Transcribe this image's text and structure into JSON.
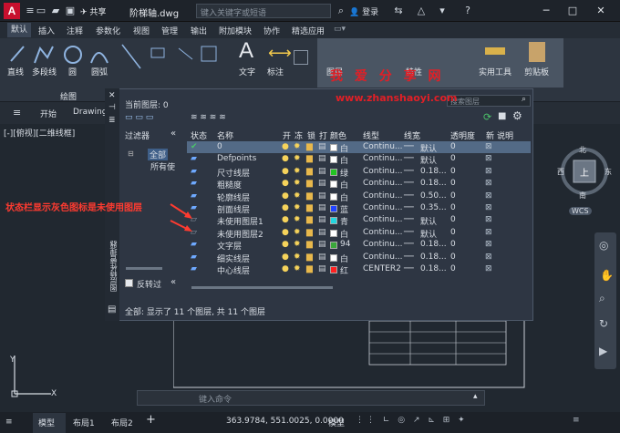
{
  "app": {
    "logo": "A",
    "file_title": "阶梯轴.dwg",
    "share_label": "共享",
    "search_placeholder": "键入关键字或短语",
    "login_label": "登录"
  },
  "ribbon_tabs": [
    "默认",
    "插入",
    "注释",
    "参数化",
    "视图",
    "管理",
    "输出",
    "附加模块",
    "协作",
    "精选应用"
  ],
  "ribbon": {
    "draw_tools": [
      "直线",
      "多段线",
      "圆",
      "圆弧"
    ],
    "text_label": "文字",
    "dim_label": "标注",
    "group_label": "绘图",
    "layer_label": "图层",
    "properties_label": "特性",
    "utilities_label": "实用工具",
    "clipboard_label": "剪贴板"
  },
  "subbar": {
    "start_tab": "开始",
    "drawing_tab": "Drawing"
  },
  "viewport_label": "[-][俯视][二维线框]",
  "layer_manager": {
    "current_layer": "当前图层: 0",
    "search_placeholder": "搜索图层",
    "filter_header": "过滤器",
    "filter_all": "全部",
    "filter_used": "所有使",
    "invert_filter": "反转过",
    "side_title": "图层特性管理器",
    "columns": [
      "状态",
      "名称",
      "开",
      "冻",
      "锁",
      "打",
      "颜色",
      "线型",
      "线宽",
      "透明度",
      "新",
      "说明"
    ],
    "rows": [
      {
        "name": "0",
        "color_name": "白",
        "color": "#ffffff",
        "linetype": "Continu...",
        "lineweight": "默认",
        "transparency": "0",
        "selected": true,
        "current": true
      },
      {
        "name": "Defpoints",
        "color_name": "白",
        "color": "#ffffff",
        "linetype": "Continu...",
        "lineweight": "默认",
        "transparency": "0"
      },
      {
        "name": "尺寸线层",
        "color_name": "绿",
        "color": "#22c522",
        "linetype": "Continu...",
        "lineweight": "0.18...",
        "transparency": "0"
      },
      {
        "name": "粗糙度",
        "color_name": "白",
        "color": "#ffffff",
        "linetype": "Continu...",
        "lineweight": "0.18...",
        "transparency": "0"
      },
      {
        "name": "轮廓线层",
        "color_name": "白",
        "color": "#ffffff",
        "linetype": "Continu...",
        "lineweight": "0.50...",
        "transparency": "0"
      },
      {
        "name": "剖面线层",
        "color_name": "蓝",
        "color": "#2244ff",
        "linetype": "Continu...",
        "lineweight": "0.35...",
        "transparency": "0"
      },
      {
        "name": "未使用图层1",
        "color_name": "青",
        "color": "#22d6e0",
        "linetype": "Continu...",
        "lineweight": "默认",
        "transparency": "0",
        "unused": true
      },
      {
        "name": "未使用图层2",
        "color_name": "白",
        "color": "#ffffff",
        "linetype": "Continu...",
        "lineweight": "默认",
        "transparency": "0",
        "unused": true
      },
      {
        "name": "文字层",
        "color_name": "94",
        "color": "#3aa83a",
        "linetype": "Continu...",
        "lineweight": "0.18...",
        "transparency": "0"
      },
      {
        "name": "细实线层",
        "color_name": "白",
        "color": "#ffffff",
        "linetype": "Continu...",
        "lineweight": "0.18...",
        "transparency": "0"
      },
      {
        "name": "中心线层",
        "color_name": "红",
        "color": "#ff2020",
        "linetype": "CENTER2",
        "lineweight": "0.18...",
        "transparency": "0"
      }
    ],
    "footer": "全部: 显示了 11 个图层, 共 11 个图层"
  },
  "annotation": "状态栏显示灰色图标是未使用图层",
  "watermark": {
    "cn": "我 爱 分 享 网",
    "url": "www.zhanshaoyi.com"
  },
  "viewcube": {
    "north": "北",
    "south": "南",
    "west": "西",
    "east": "东",
    "top": "上",
    "wcs": "WCS"
  },
  "command_placeholder": "键入命令",
  "status": {
    "model_tab": "模型",
    "layout1": "布局1",
    "layout2": "布局2",
    "coords": "363.9784, 551.0025, 0.0000",
    "model_btn": "模型"
  },
  "axis": {
    "x": "X",
    "y": "Y"
  }
}
